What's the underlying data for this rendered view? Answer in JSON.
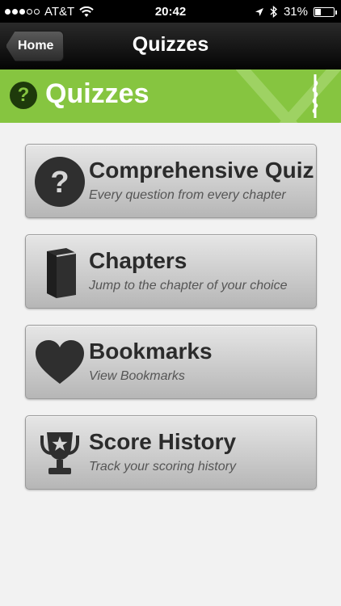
{
  "status_bar": {
    "carrier": "AT&T",
    "time": "20:42",
    "battery": "31%",
    "battery_level": 0.31
  },
  "nav": {
    "back_label": "Home",
    "title": "Quizzes"
  },
  "header": {
    "icon": "question-icon",
    "title": "Quizzes",
    "accent_color": "#86c540"
  },
  "menu": [
    {
      "icon": "question-circle-icon",
      "title": "Comprehensive Quiz",
      "subtitle": "Every question from every chapter"
    },
    {
      "icon": "book-icon",
      "title": "Chapters",
      "subtitle": "Jump to the chapter of your choice"
    },
    {
      "icon": "heart-icon",
      "title": "Bookmarks",
      "subtitle": "View Bookmarks"
    },
    {
      "icon": "trophy-icon",
      "title": "Score History",
      "subtitle": "Track your scoring history"
    }
  ]
}
